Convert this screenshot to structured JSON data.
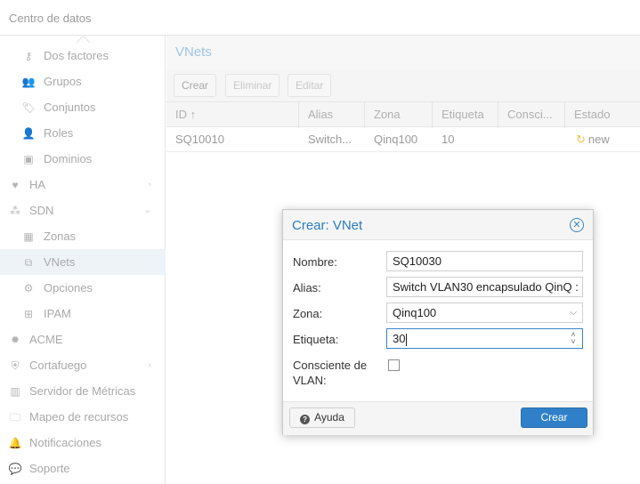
{
  "header": {
    "breadcrumb": "Centro de datos"
  },
  "sidebar": {
    "items": [
      {
        "label": "Dos factores",
        "icon": "key-icon",
        "glyph": "⚷",
        "level": 1
      },
      {
        "label": "Grupos",
        "icon": "users-icon",
        "glyph": "👥",
        "level": 1
      },
      {
        "label": "Conjuntos",
        "icon": "tags-icon",
        "glyph": "🏷",
        "level": 1
      },
      {
        "label": "Roles",
        "icon": "person-icon",
        "glyph": "👤",
        "level": 1
      },
      {
        "label": "Dominios",
        "icon": "address-book-icon",
        "glyph": "▣",
        "level": 1
      },
      {
        "label": "HA",
        "icon": "heartbeat-icon",
        "glyph": "♥",
        "level": 0,
        "arrow": "›"
      },
      {
        "label": "SDN",
        "icon": "sdn-icon",
        "glyph": "⁂",
        "level": 0,
        "arrow": "⌄"
      },
      {
        "label": "Zonas",
        "icon": "grid-icon",
        "glyph": "▦",
        "level": 1
      },
      {
        "label": "VNets",
        "icon": "network-icon",
        "glyph": "⧉",
        "level": 1,
        "selected": true
      },
      {
        "label": "Opciones",
        "icon": "gear-icon",
        "glyph": "⚙",
        "level": 1
      },
      {
        "label": "IPAM",
        "icon": "signpost-icon",
        "glyph": "⊞",
        "level": 1
      },
      {
        "label": "ACME",
        "icon": "certificate-icon",
        "glyph": "✹",
        "level": 0
      },
      {
        "label": "Cortafuego",
        "icon": "shield-icon",
        "glyph": "⛨",
        "level": 0,
        "arrow": "›"
      },
      {
        "label": "Servidor de Métricas",
        "icon": "bar-chart-icon",
        "glyph": "▥",
        "level": 0
      },
      {
        "label": "Mapeo de recursos",
        "icon": "folder-icon",
        "glyph": "🗀",
        "level": 0
      },
      {
        "label": "Notificaciones",
        "icon": "bell-icon",
        "glyph": "🔔",
        "level": 0
      },
      {
        "label": "Soporte",
        "icon": "comments-icon",
        "glyph": "💬",
        "level": 0
      }
    ]
  },
  "panel": {
    "title": "VNets",
    "toolbar": {
      "create": "Crear",
      "delete": "Eliminar",
      "edit": "Editar"
    },
    "columns": [
      "ID ↑",
      "Alias",
      "Zona",
      "Etiqueta",
      "Consci...",
      "Estado"
    ],
    "rows": [
      {
        "id": "SQ10010",
        "alias": "Switch...",
        "zone": "Qinq100",
        "tag": "10",
        "vlan_aware": "",
        "state": "new",
        "state_icon": "↻"
      }
    ]
  },
  "dialog": {
    "title": "Crear: VNet",
    "close_icon": "ⓧ",
    "fields": {
      "name_label": "Nombre:",
      "name_value": "SQ10030",
      "alias_label": "Alias:",
      "alias_value": "Switch VLAN30 encapsulado QinQ :",
      "zone_label": "Zona:",
      "zone_value": "Qinq100",
      "tag_label": "Etiqueta:",
      "tag_value": "30",
      "vlan_label_1": "Consciente de",
      "vlan_label_2": "VLAN:",
      "vlan_checked": false
    },
    "help_label": "Ayuda",
    "create_label": "Crear"
  }
}
